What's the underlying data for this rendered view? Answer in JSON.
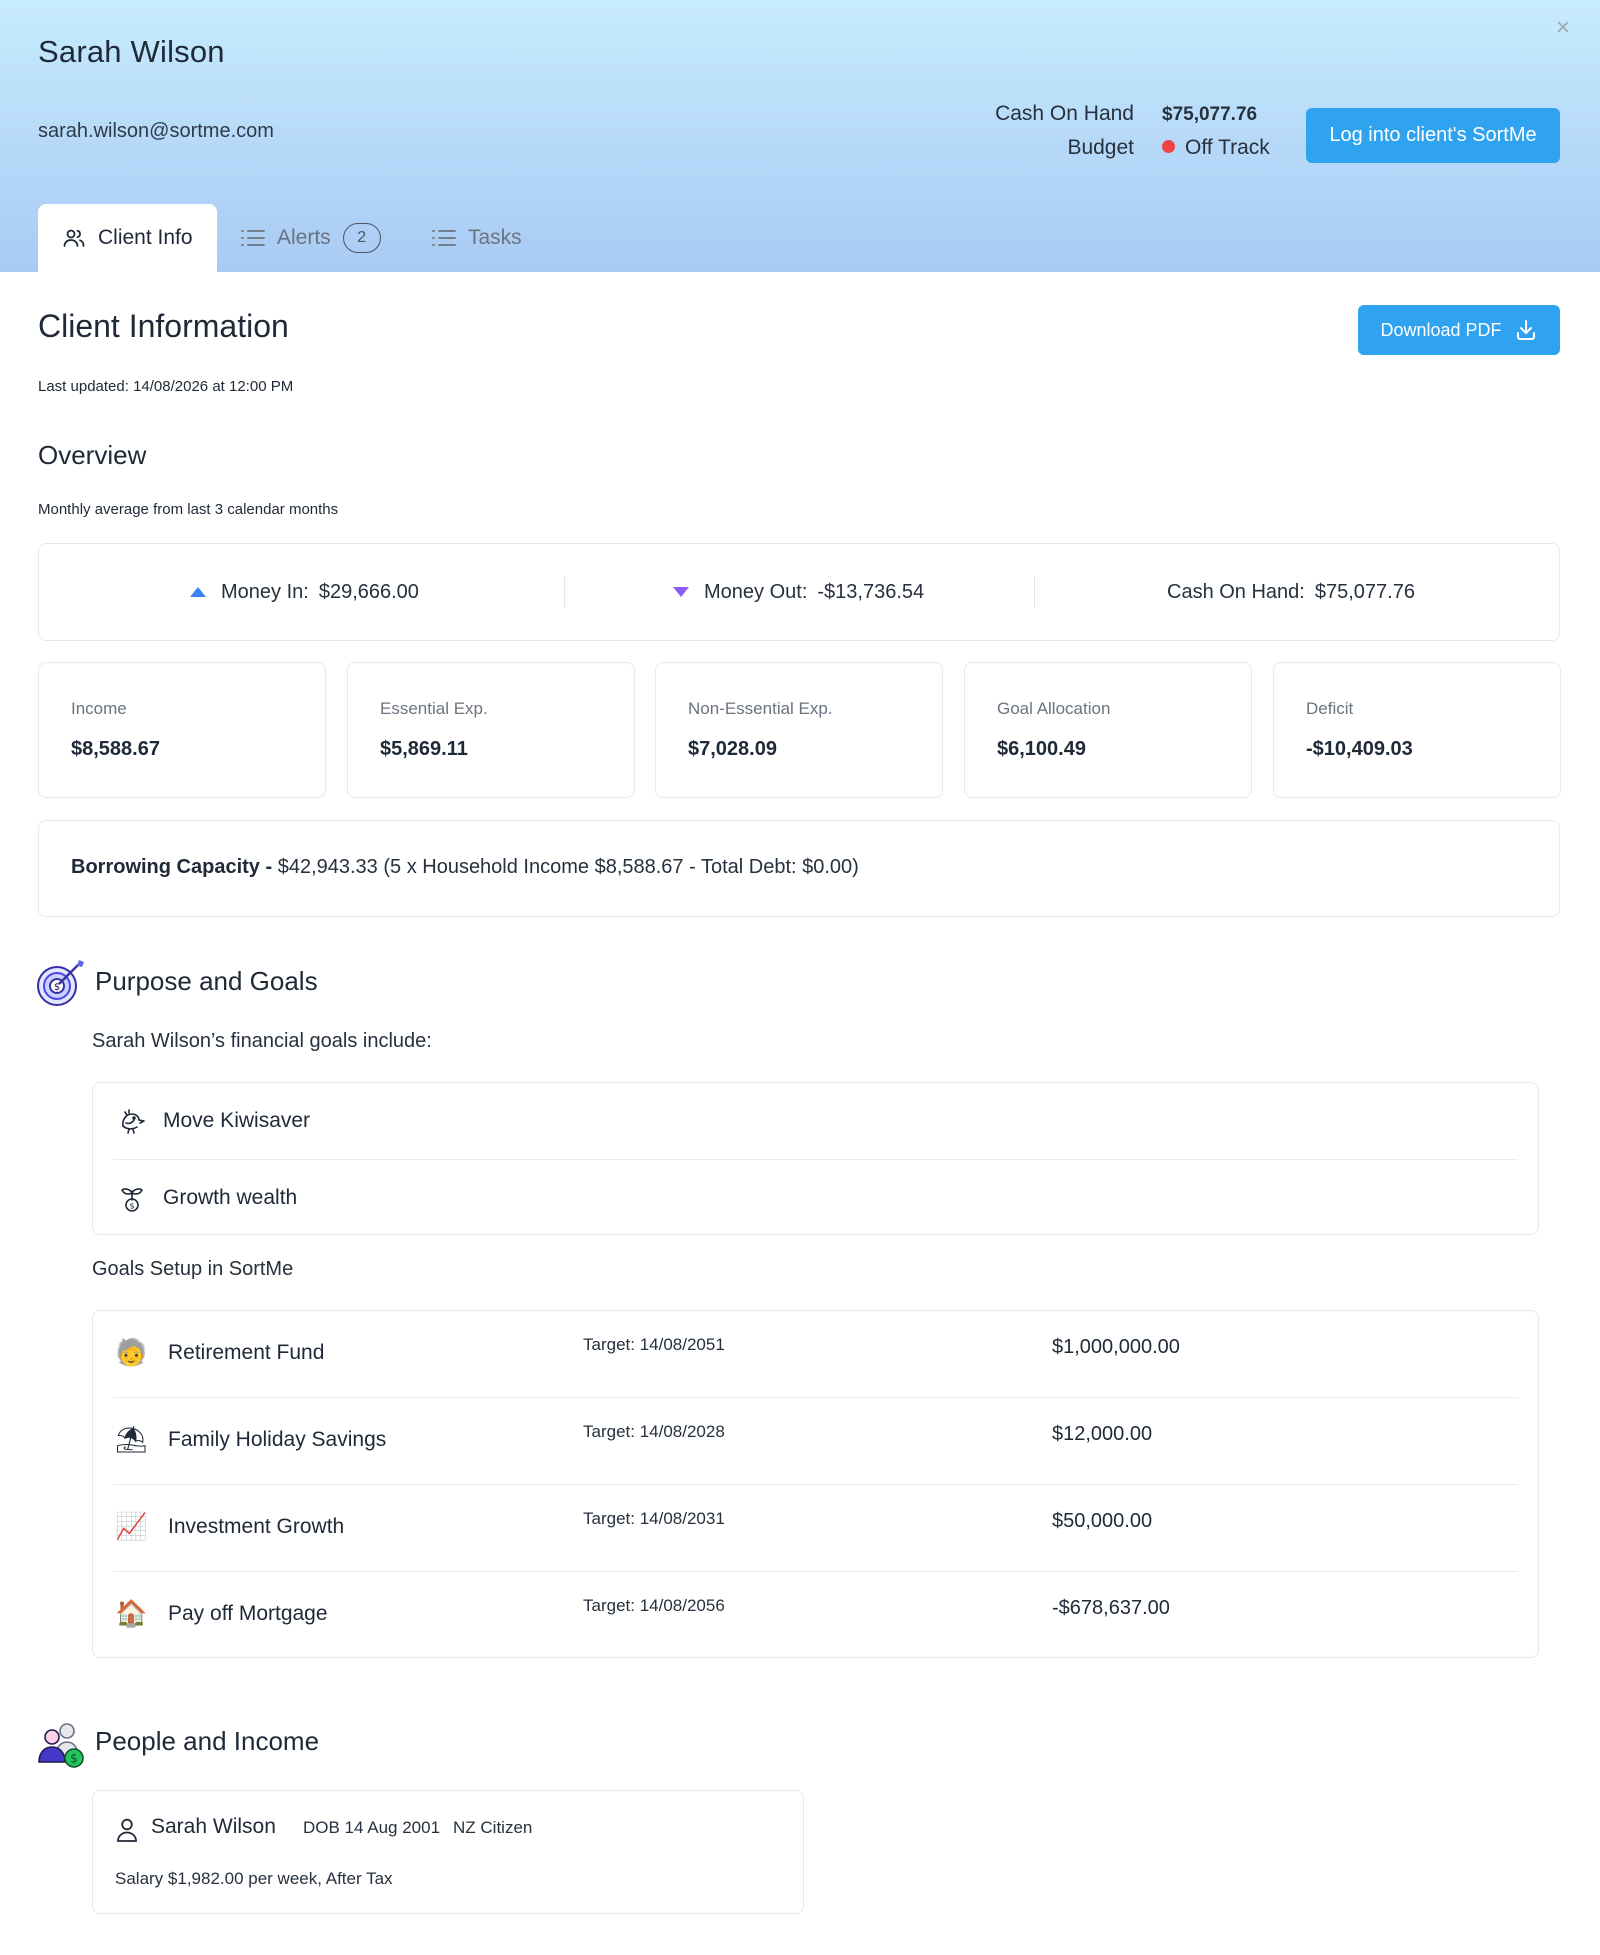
{
  "header": {
    "close_glyph": "×",
    "client_name": "Sarah Wilson",
    "email": "sarah.wilson@sortme.com",
    "cash_on_hand_label": "Cash On Hand",
    "cash_on_hand_value": "$75,077.76",
    "budget_label": "Budget",
    "budget_status": "Off Track",
    "budget_status_color": "#ef4444",
    "login_button": "Log into client's SortMe"
  },
  "tabs": [
    {
      "label": "Client Info",
      "icon": "users-icon",
      "active": true
    },
    {
      "label": "Alerts",
      "icon": "list-icon",
      "badge": "2"
    },
    {
      "label": "Tasks",
      "icon": "list-icon"
    }
  ],
  "client_info": {
    "title": "Client Information",
    "last_updated": "Last updated: 14/08/2026 at 12:00 PM",
    "download_button": "Download PDF"
  },
  "overview": {
    "title": "Overview",
    "subtitle": "Monthly average from last 3 calendar months",
    "money_in_label": "Money In:",
    "money_in_value": "$29,666.00",
    "money_out_label": "Money Out:",
    "money_out_value": "-$13,736.54",
    "cash_on_hand_label": "Cash On Hand:",
    "cash_on_hand_value": "$75,077.76",
    "stats": [
      {
        "label": "Income",
        "value": "$8,588.67"
      },
      {
        "label": "Essential Exp.",
        "value": "$5,869.11"
      },
      {
        "label": "Non-Essential Exp.",
        "value": "$7,028.09"
      },
      {
        "label": "Goal Allocation",
        "value": "$6,100.49"
      },
      {
        "label": "Deficit",
        "value": "-$10,409.03"
      }
    ],
    "borrowing_label": "Borrowing Capacity -",
    "borrowing_text": " $42,943.33 (5 x Household Income $8,588.67 - Total Debt: $0.00)"
  },
  "purpose": {
    "title": "Purpose and Goals",
    "intro": "Sarah Wilson’s financial goals include:",
    "goals": [
      {
        "label": "Move Kiwisaver",
        "icon": "bird-icon"
      },
      {
        "label": "Growth wealth",
        "icon": "money-plant-icon"
      }
    ],
    "setup_label": "Goals Setup in SortMe",
    "setup": [
      {
        "icon": "🧓",
        "name": "Retirement Fund",
        "target": "Target: 14/08/2051",
        "amount": "$1,000,000.00"
      },
      {
        "icon": "⛱",
        "name": "Family Holiday Savings",
        "target": "Target: 14/08/2028",
        "amount": "$12,000.00"
      },
      {
        "icon": "📈",
        "name": "Investment Growth",
        "target": "Target: 14/08/2031",
        "amount": "$50,000.00"
      },
      {
        "icon": "🏠",
        "name": "Pay off Mortgage",
        "target": "Target: 14/08/2056",
        "amount": "-$678,637.00"
      }
    ]
  },
  "people": {
    "title": "People and Income",
    "person_name": "Sarah Wilson",
    "dob": "DOB 14 Aug 2001",
    "citizenship": "NZ Citizen",
    "salary": "Salary $1,982.00 per week, After Tax"
  },
  "colors": {
    "accent": "#2fa3ef",
    "header_top": "#c7ecfd",
    "header_bottom": "#a9cbf3",
    "up_arrow": "#3b82f6",
    "down_arrow": "#8b5cf6"
  }
}
